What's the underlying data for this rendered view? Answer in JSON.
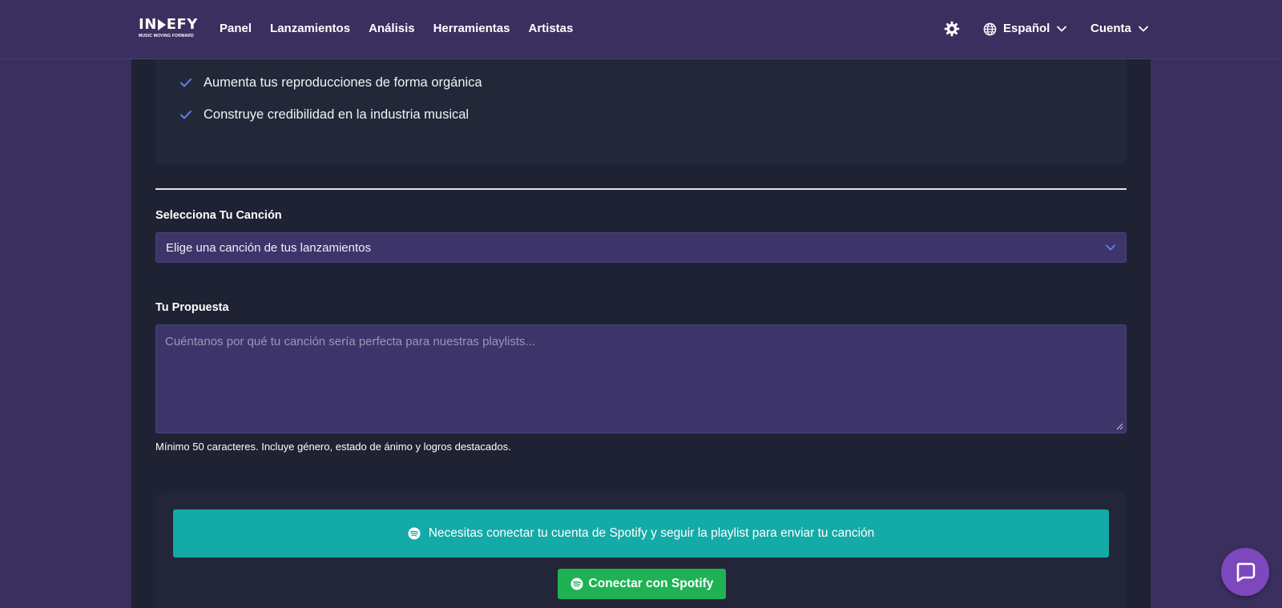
{
  "brand": {
    "name_prefix": "IN",
    "name_suffix": "EFY",
    "tagline": "MUSIC MOVING FORWARD"
  },
  "nav": {
    "items": [
      {
        "label": "Panel"
      },
      {
        "label": "Lanzamientos"
      },
      {
        "label": "Análisis"
      },
      {
        "label": "Herramientas"
      },
      {
        "label": "Artistas"
      }
    ]
  },
  "header": {
    "language_label": "Español",
    "account_label": "Cuenta"
  },
  "benefits": {
    "items": [
      {
        "text": "Aumenta tus reproducciones de forma orgánica"
      },
      {
        "text": "Construye credibilidad en la industria musical"
      }
    ]
  },
  "form": {
    "song_label": "Selecciona Tu Canción",
    "song_select_value": "Elige una canción de tus lanzamientos",
    "pitch_label": "Tu Propuesta",
    "pitch_placeholder": "Cuéntanos por qué tu canción sería perfecta para nuestras playlists...",
    "pitch_hint": "Mínimo 50 caracteres. Incluye género, estado de ánimo y logros destacados."
  },
  "spotify": {
    "notice": "Necesitas conectar tu cuenta de Spotify y seguir la playlist para enviar tu canción",
    "connect_label": "Conectar con Spotify"
  },
  "colors": {
    "header_bg": "#3a2f5e",
    "panel_bg": "#1e2232",
    "input_bg": "#3d356a",
    "accent_check": "#6b7cf5",
    "notice_bg": "#14aaa7",
    "spotify_green": "#1fb254",
    "chat_bg": "#7d47bd"
  },
  "icons": {
    "theme": "gear-icon",
    "language": "globe-icon",
    "chevron": "chevron-down-icon",
    "check": "check-icon",
    "spotify": "spotify-icon",
    "chat": "chat-bubble-icon"
  }
}
